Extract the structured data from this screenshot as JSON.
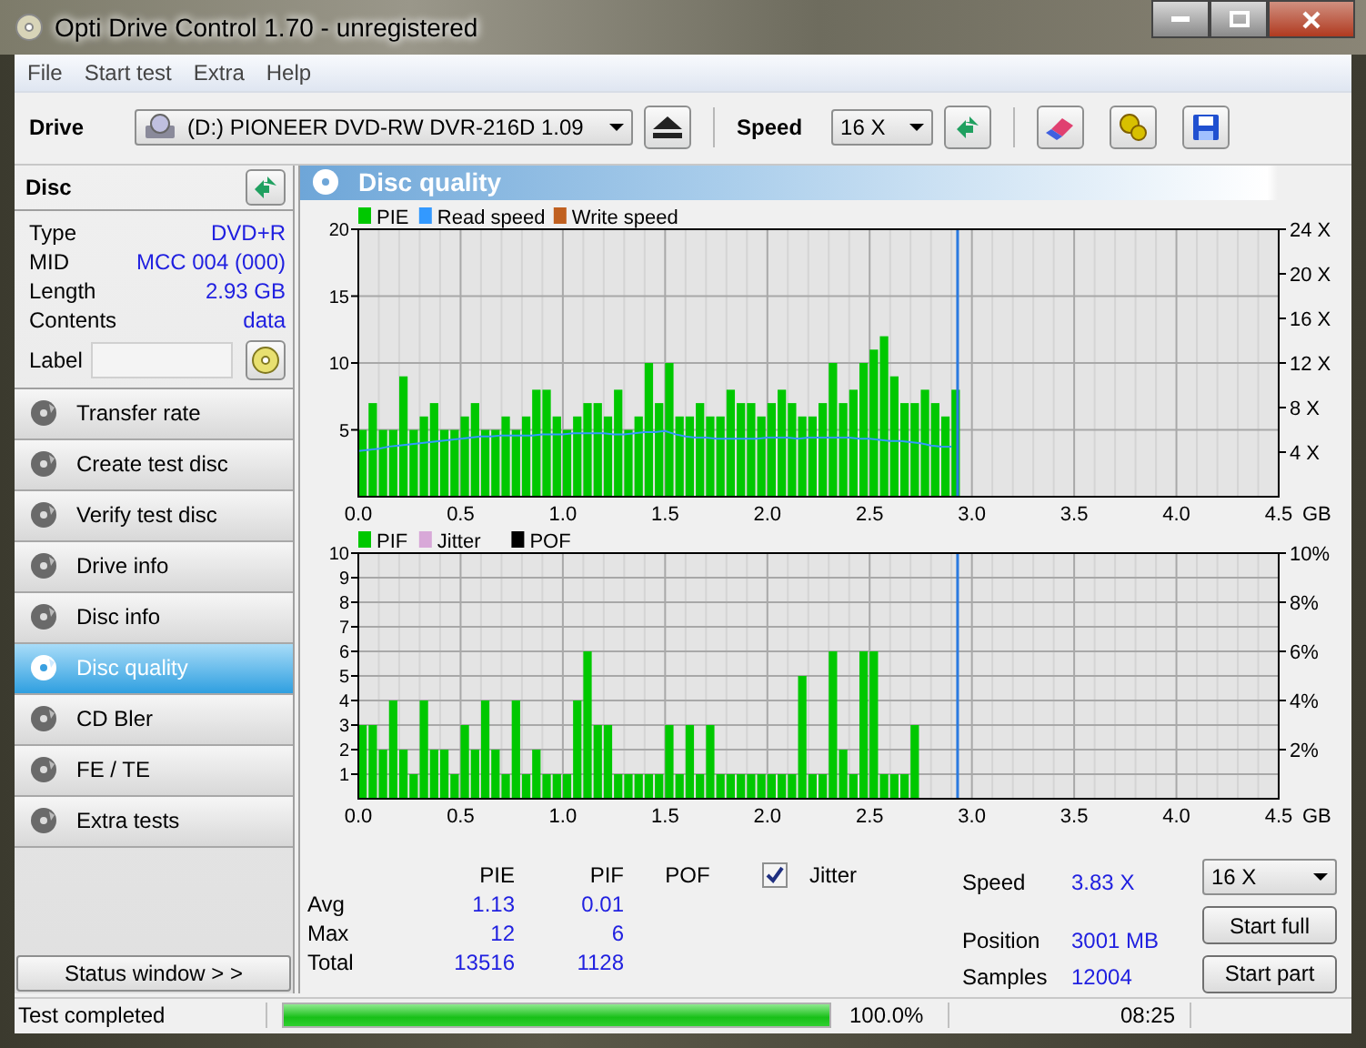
{
  "window": {
    "title": "Opti Drive Control 1.70 - unregistered"
  },
  "menu": [
    "File",
    "Start test",
    "Extra",
    "Help"
  ],
  "toolbar": {
    "drive_label": "Drive",
    "drive": "(D:)   PIONEER DVD-RW  DVR-216D 1.09",
    "speed_label": "Speed",
    "speed": "16 X"
  },
  "disc": {
    "title": "Disc",
    "fields": [
      {
        "label": "Type",
        "value": "DVD+R"
      },
      {
        "label": "MID",
        "value": "MCC 004 (000)"
      },
      {
        "label": "Length",
        "value": "2.93 GB"
      },
      {
        "label": "Contents",
        "value": "data"
      }
    ],
    "label_field": {
      "label": "Label"
    }
  },
  "nav": [
    {
      "label": "Transfer rate",
      "selected": false
    },
    {
      "label": "Create test disc",
      "selected": false
    },
    {
      "label": "Verify test disc",
      "selected": false
    },
    {
      "label": "Drive info",
      "selected": false
    },
    {
      "label": "Disc info",
      "selected": false
    },
    {
      "label": "Disc quality",
      "selected": true
    },
    {
      "label": "CD Bler",
      "selected": false
    },
    {
      "label": "FE / TE",
      "selected": false
    },
    {
      "label": "Extra tests",
      "selected": false
    }
  ],
  "status_window_button": "Status window > >",
  "panel": {
    "title": "Disc quality",
    "chart_top": {
      "chart_data": {
        "type": "bar",
        "xlabel": "GB",
        "xlim": [
          0,
          4.5
        ],
        "ylim": [
          0,
          20
        ],
        "y2lim": [
          0,
          24
        ],
        "xticks": [
          {
            "value": 0,
            "label": "0.0"
          },
          {
            "value": 0.5,
            "label": "0.5"
          },
          {
            "value": 1,
            "label": "1.0"
          },
          {
            "value": 1.5,
            "label": "1.5"
          },
          {
            "value": 2,
            "label": "2.0"
          },
          {
            "value": 2.5,
            "label": "2.5"
          },
          {
            "value": 3,
            "label": "3.0"
          },
          {
            "value": 3.5,
            "label": "3.5"
          },
          {
            "value": 4,
            "label": "4.0"
          },
          {
            "value": 4.5,
            "label": "4.5"
          }
        ],
        "yticks": [
          5,
          10,
          15,
          20
        ],
        "y2ticks": [
          {
            "value": 4,
            "label": "4 X"
          },
          {
            "value": 8,
            "label": "8 X"
          },
          {
            "value": 12,
            "label": "12 X"
          },
          {
            "value": 16,
            "label": "16 X"
          },
          {
            "value": 20,
            "label": "20 X"
          },
          {
            "value": 24,
            "label": "24 X"
          }
        ],
        "grid": true,
        "legend": true,
        "ref_lines": [
          {
            "axis": "x",
            "value": 2.93,
            "color": "#2a7ae0"
          }
        ],
        "x": [
          0,
          0.05,
          0.1,
          0.15,
          0.2,
          0.25,
          0.3,
          0.35,
          0.4,
          0.45,
          0.5,
          0.55,
          0.6,
          0.65,
          0.7,
          0.75,
          0.8,
          0.85,
          0.9,
          0.95,
          1,
          1.05,
          1.1,
          1.15,
          1.2,
          1.25,
          1.3,
          1.35,
          1.4,
          1.45,
          1.5,
          1.55,
          1.6,
          1.65,
          1.7,
          1.75,
          1.8,
          1.85,
          1.9,
          1.95,
          2,
          2.05,
          2.1,
          2.15,
          2.2,
          2.25,
          2.3,
          2.35,
          2.4,
          2.45,
          2.5,
          2.55,
          2.6,
          2.65,
          2.7,
          2.75,
          2.8,
          2.85,
          2.9
        ],
        "series": [
          {
            "name": "PIE",
            "color": "#00c800",
            "values": [
              5,
              7,
              5,
              5,
              9,
              5,
              6,
              7,
              5,
              5,
              6,
              7,
              5,
              5,
              6,
              5,
              6,
              8,
              8,
              6,
              5,
              6,
              7,
              7,
              6,
              8,
              5,
              6,
              10,
              7,
              10,
              6,
              6,
              7,
              6,
              6,
              8,
              7,
              7,
              6,
              7,
              8,
              7,
              6,
              6,
              7,
              10,
              7,
              8,
              10,
              11,
              12,
              9,
              7,
              7,
              8,
              7,
              6,
              8
            ]
          },
          {
            "name": "Read speed",
            "color": "#3399ff",
            "axis": "y2",
            "type": "line",
            "values": [
              4.1,
              4.2,
              4.3,
              4.5,
              4.6,
              4.7,
              4.8,
              4.9,
              5,
              5.1,
              5.2,
              5.3,
              5.4,
              5.4,
              5.5,
              5.5,
              5.5,
              5.5,
              5.6,
              5.6,
              5.6,
              5.7,
              5.7,
              5.7,
              5.7,
              5.6,
              5.6,
              5.7,
              5.8,
              5.8,
              5.9,
              5.6,
              5.4,
              5.3,
              5.3,
              5.2,
              5.2,
              5.2,
              5.2,
              5.2,
              5.3,
              5.3,
              5.3,
              5.2,
              5.3,
              5.3,
              5.3,
              5.3,
              5.3,
              5.2,
              5.2,
              5.1,
              5,
              5,
              4.9,
              4.8,
              4.6,
              4.5,
              4.5
            ]
          },
          {
            "name": "Write speed",
            "color": "#c06020",
            "values": [
              null,
              null,
              null,
              null,
              null,
              null,
              null,
              null,
              null,
              null,
              null,
              null,
              null,
              null,
              null,
              null,
              null,
              null,
              null,
              null,
              null,
              null,
              null,
              null,
              null,
              null,
              null,
              null,
              null,
              null,
              null,
              null,
              null,
              null,
              null,
              null,
              null,
              null,
              null,
              null,
              null,
              null,
              null,
              null,
              null,
              null,
              null,
              null,
              null,
              null,
              null,
              null,
              null,
              null,
              null,
              null,
              null,
              null,
              null
            ]
          }
        ]
      }
    },
    "chart_bottom": {
      "chart_data": {
        "type": "bar",
        "xlabel": "GB",
        "xlim": [
          0,
          4.5
        ],
        "ylim": [
          0,
          10
        ],
        "y2lim": [
          0,
          10
        ],
        "xticks": [
          {
            "value": 0,
            "label": "0.0"
          },
          {
            "value": 0.5,
            "label": "0.5"
          },
          {
            "value": 1,
            "label": "1.0"
          },
          {
            "value": 1.5,
            "label": "1.5"
          },
          {
            "value": 2,
            "label": "2.0"
          },
          {
            "value": 2.5,
            "label": "2.5"
          },
          {
            "value": 3,
            "label": "3.0"
          },
          {
            "value": 3.5,
            "label": "3.5"
          },
          {
            "value": 4,
            "label": "4.0"
          },
          {
            "value": 4.5,
            "label": "4.5"
          }
        ],
        "yticks": [
          1,
          2,
          3,
          4,
          5,
          6,
          7,
          8,
          9,
          10
        ],
        "y2ticks": [
          {
            "value": 2,
            "label": "2%"
          },
          {
            "value": 4,
            "label": "4%"
          },
          {
            "value": 6,
            "label": "6%"
          },
          {
            "value": 8,
            "label": "8%"
          },
          {
            "value": 10,
            "label": "10%"
          }
        ],
        "grid": true,
        "legend": true,
        "ref_lines": [
          {
            "axis": "x",
            "value": 2.93,
            "color": "#2a7ae0"
          }
        ],
        "x": [
          0,
          0.05,
          0.1,
          0.15,
          0.2,
          0.25,
          0.3,
          0.35,
          0.4,
          0.45,
          0.5,
          0.55,
          0.6,
          0.65,
          0.7,
          0.75,
          0.8,
          0.85,
          0.9,
          0.95,
          1,
          1.05,
          1.1,
          1.15,
          1.2,
          1.25,
          1.3,
          1.35,
          1.4,
          1.45,
          1.5,
          1.55,
          1.6,
          1.65,
          1.7,
          1.75,
          1.8,
          1.85,
          1.9,
          1.95,
          2,
          2.05,
          2.1,
          2.15,
          2.2,
          2.25,
          2.3,
          2.35,
          2.4,
          2.45,
          2.5,
          2.55,
          2.6,
          2.65,
          2.7,
          2.75,
          2.8,
          2.85,
          2.9
        ],
        "series": [
          {
            "name": "PIF",
            "color": "#00c800",
            "values": [
              3,
              3,
              2,
              4,
              2,
              1,
              4,
              2,
              2,
              1,
              3,
              2,
              4,
              2,
              1,
              4,
              1,
              2,
              1,
              1,
              1,
              4,
              6,
              3,
              3,
              1,
              1,
              1,
              1,
              1,
              3,
              1,
              3,
              1,
              3,
              1,
              1,
              1,
              1,
              1,
              1,
              1,
              1,
              5,
              1,
              1,
              6,
              2,
              1,
              6,
              6,
              1,
              1,
              1,
              3,
              0,
              0,
              0,
              0
            ]
          },
          {
            "name": "Jitter",
            "color": "#d8a8d8",
            "values": [
              null,
              null,
              null,
              null,
              null,
              null,
              null,
              null,
              null,
              null,
              null,
              null,
              null,
              null,
              null,
              null,
              null,
              null,
              null,
              null,
              null,
              null,
              null,
              null,
              null,
              null,
              null,
              null,
              null,
              null,
              null,
              null,
              null,
              null,
              null,
              null,
              null,
              null,
              null,
              null,
              null,
              null,
              null,
              null,
              null,
              null,
              null,
              null,
              null,
              null,
              null,
              null,
              null,
              null,
              null,
              null,
              null,
              null,
              null
            ]
          },
          {
            "name": "POF",
            "color": "#000000",
            "values": [
              null,
              null,
              null,
              null,
              null,
              null,
              null,
              null,
              null,
              null,
              null,
              null,
              null,
              null,
              null,
              null,
              null,
              null,
              null,
              null,
              null,
              null,
              null,
              null,
              null,
              null,
              null,
              null,
              null,
              null,
              null,
              null,
              null,
              null,
              null,
              null,
              null,
              null,
              null,
              null,
              null,
              null,
              null,
              null,
              null,
              null,
              null,
              null,
              null,
              null,
              null,
              null,
              null,
              null,
              null,
              null,
              null,
              null,
              null
            ]
          }
        ]
      }
    },
    "stats": {
      "columns": [
        "PIE",
        "PIF",
        "POF"
      ],
      "jitter": {
        "label": "Jitter",
        "checked": true
      },
      "rows": [
        {
          "label": "Avg",
          "values": [
            "1.13",
            "0.01"
          ]
        },
        {
          "label": "Max",
          "values": [
            "12",
            "6"
          ]
        },
        {
          "label": "Total",
          "values": [
            "13516",
            "1128"
          ]
        }
      ]
    },
    "readings": [
      {
        "label": "Speed",
        "value": "3.83 X"
      },
      {
        "label": "Position",
        "value": "3001 MB"
      },
      {
        "label": "Samples",
        "value": "12004"
      }
    ],
    "speed_select": "16 X",
    "buttons": [
      "Start full",
      "Start part"
    ]
  },
  "status_bar": {
    "message": "Test completed",
    "progress": {
      "level": 1.0,
      "text": "100.0%"
    },
    "time": "08:25"
  }
}
